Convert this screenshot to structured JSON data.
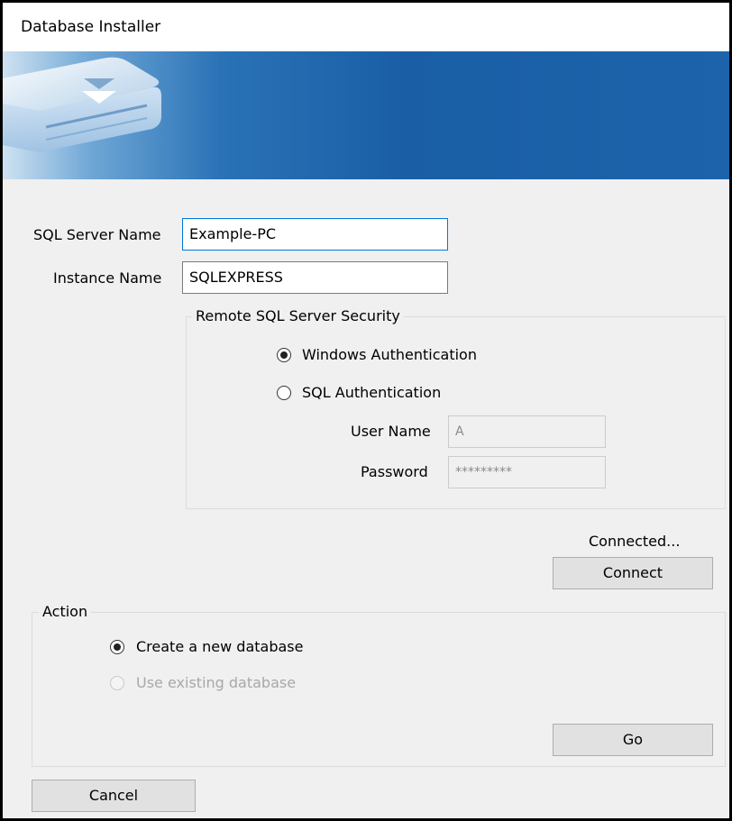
{
  "window": {
    "title": "Database Installer"
  },
  "banner": {
    "icon": "database-drive-download-icon"
  },
  "connection": {
    "server_name_label": "SQL Server Name",
    "server_name_value": "Example-PC",
    "instance_name_label": "Instance Name",
    "instance_name_value": "SQLEXPRESS"
  },
  "security": {
    "group_label": "Remote SQL Server Security",
    "windows_auth_label": "Windows Authentication",
    "sql_auth_label": "SQL Authentication",
    "selected": "Windows Authentication",
    "user_name_label": "User Name",
    "user_name_value": "A",
    "password_label": "Password",
    "password_value": "*********"
  },
  "status": {
    "text": "Connected..."
  },
  "buttons": {
    "connect": "Connect",
    "go": "Go",
    "cancel": "Cancel"
  },
  "action": {
    "group_label": "Action",
    "create_label": "Create a new database",
    "existing_label": "Use existing database",
    "selected": "Create a new database"
  },
  "colors": {
    "banner_blue": "#1a5fa6",
    "focus_border": "#0078d7",
    "window_bg": "#f0f0f0"
  }
}
